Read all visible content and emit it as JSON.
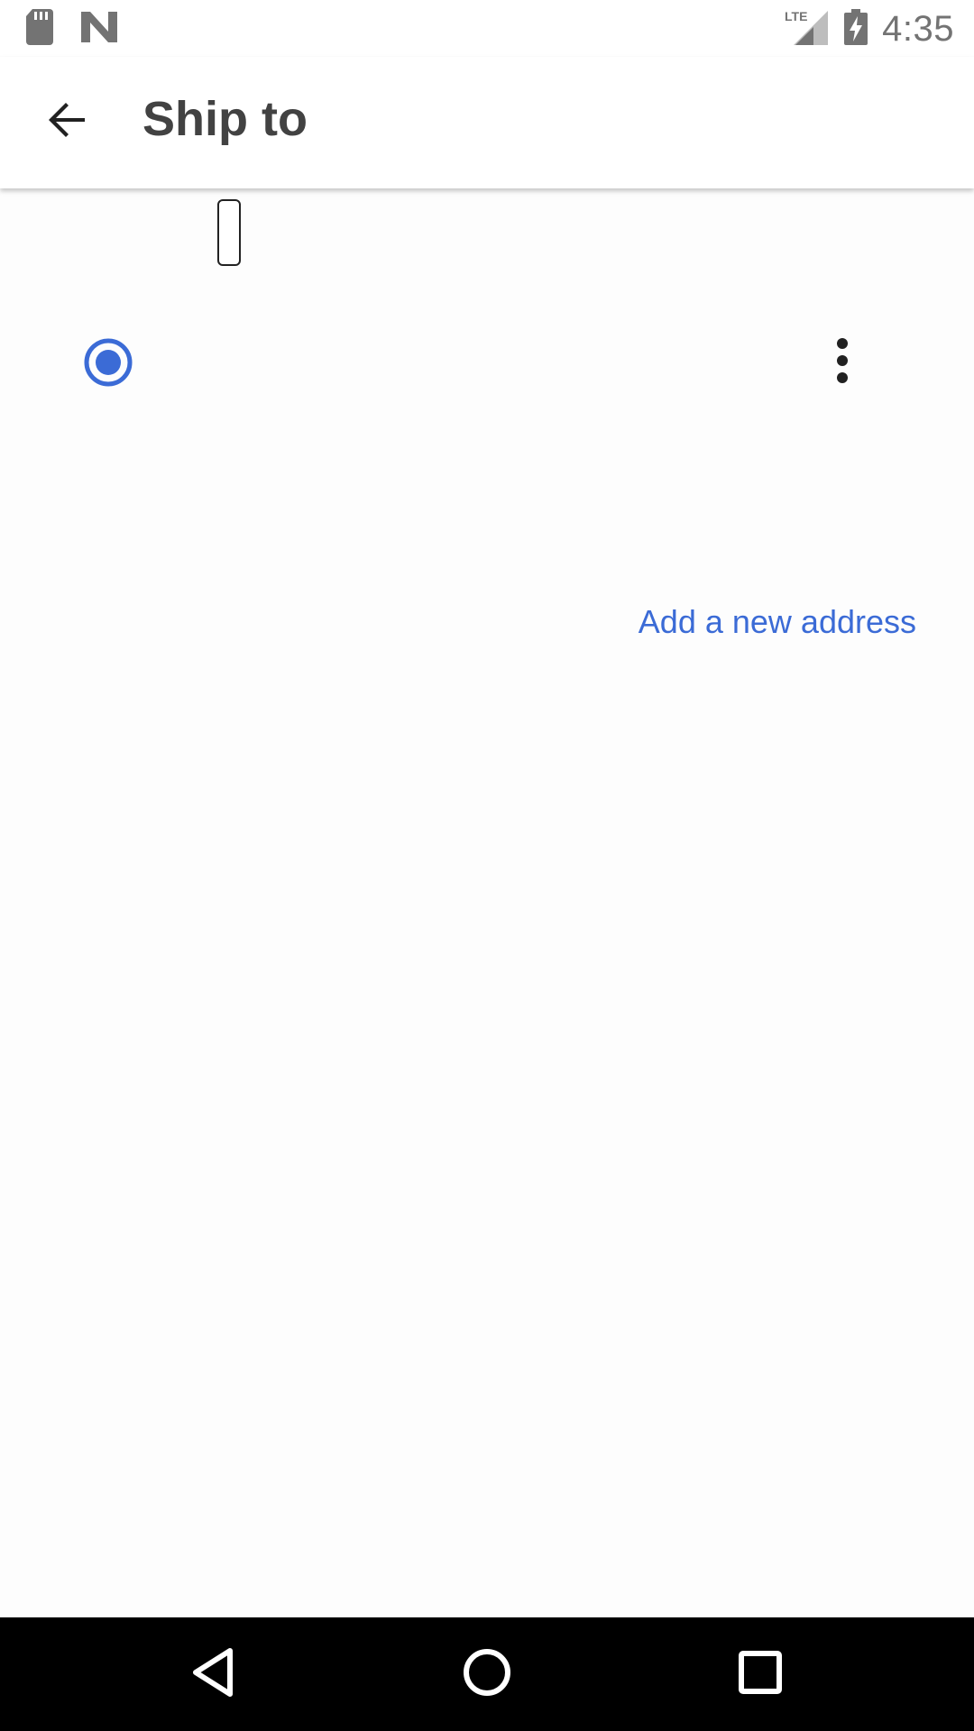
{
  "status_bar": {
    "time": "4:35",
    "left_icons": [
      "sd-card-icon",
      "n-notification-icon"
    ],
    "right_icons": [
      "lte-signal-icon",
      "battery-charging-icon"
    ],
    "network_label": "LTE"
  },
  "app_bar": {
    "title": "Ship to",
    "back_icon": "arrow-back-icon"
  },
  "address_list": {
    "items": [
      {
        "selected": true,
        "menu_icon": "more-vert-icon"
      }
    ]
  },
  "actions": {
    "add_address_label": "Add a new address"
  },
  "colors": {
    "accent": "#3b6bd6",
    "title_text": "#424242",
    "status_icons": "#737373",
    "nav_bar": "#000000"
  },
  "nav_bar": {
    "buttons": [
      "back-triangle-icon",
      "home-circle-icon",
      "recents-square-icon"
    ]
  }
}
